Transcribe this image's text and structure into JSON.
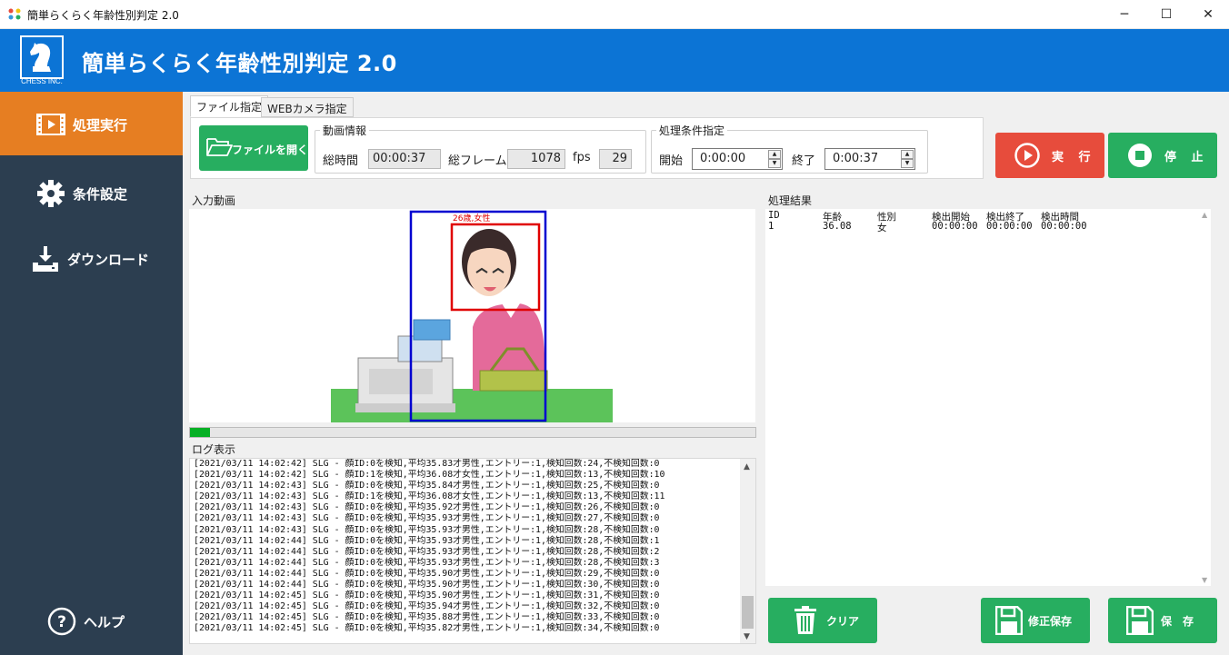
{
  "window": {
    "title": "簡単らくらく年齢性別判定 2.0",
    "minimize": "─",
    "maximize": "☐",
    "close": "✕"
  },
  "header": {
    "logo_text": "CHESS INC.",
    "app_title": "簡単らくらく年齢性別判定 2.0"
  },
  "sidebar": {
    "items": [
      {
        "label": "処理実行",
        "icon": "film-icon",
        "active": true
      },
      {
        "label": "条件設定",
        "icon": "gear-icon",
        "active": false
      },
      {
        "label": "ダウンロード",
        "icon": "download-icon",
        "active": false
      }
    ],
    "help": "ヘルプ"
  },
  "tabs": [
    "ファイル指定",
    "WEBカメラ指定"
  ],
  "file": {
    "open_label": "ファイルを開く",
    "video_info": {
      "legend": "動画情報",
      "total_time_label": "総時間",
      "total_time": "00:00:37",
      "total_frames_label": "総フレーム",
      "total_frames": "1078",
      "fps_label": "fps",
      "fps": "29"
    },
    "conditions": {
      "legend": "処理条件指定",
      "start_label": "開始",
      "start": "0:00:00",
      "end_label": "終了",
      "end": "0:00:37"
    }
  },
  "actions": {
    "run": "実 行",
    "stop": "停 止"
  },
  "input_video": {
    "label": "入力動画",
    "face_label": "26歳,女性",
    "progress": 0.035
  },
  "log": {
    "label": "ログ表示",
    "lines": [
      "[2021/03/11 14:02:42] SLG - 顔ID:0を検知,平均35.83才男性,エントリー:1,検知回数:24,不検知回数:0",
      "[2021/03/11 14:02:42] SLG - 顔ID:1を検知,平均36.08才女性,エントリー:1,検知回数:13,不検知回数:10",
      "[2021/03/11 14:02:43] SLG - 顔ID:0を検知,平均35.84才男性,エントリー:1,検知回数:25,不検知回数:0",
      "[2021/03/11 14:02:43] SLG - 顔ID:1を検知,平均36.08才女性,エントリー:1,検知回数:13,不検知回数:11",
      "[2021/03/11 14:02:43] SLG - 顔ID:0を検知,平均35.92才男性,エントリー:1,検知回数:26,不検知回数:0",
      "[2021/03/11 14:02:43] SLG - 顔ID:0を検知,平均35.93才男性,エントリー:1,検知回数:27,不検知回数:0",
      "[2021/03/11 14:02:43] SLG - 顔ID:0を検知,平均35.93才男性,エントリー:1,検知回数:28,不検知回数:0",
      "[2021/03/11 14:02:44] SLG - 顔ID:0を検知,平均35.93才男性,エントリー:1,検知回数:28,不検知回数:1",
      "[2021/03/11 14:02:44] SLG - 顔ID:0を検知,平均35.93才男性,エントリー:1,検知回数:28,不検知回数:2",
      "[2021/03/11 14:02:44] SLG - 顔ID:0を検知,平均35.93才男性,エントリー:1,検知回数:28,不検知回数:3",
      "[2021/03/11 14:02:44] SLG - 顔ID:0を検知,平均35.90才男性,エントリー:1,検知回数:29,不検知回数:0",
      "[2021/03/11 14:02:44] SLG - 顔ID:0を検知,平均35.90才男性,エントリー:1,検知回数:30,不検知回数:0",
      "[2021/03/11 14:02:45] SLG - 顔ID:0を検知,平均35.90才男性,エントリー:1,検知回数:31,不検知回数:0",
      "[2021/03/11 14:02:45] SLG - 顔ID:0を検知,平均35.94才男性,エントリー:1,検知回数:32,不検知回数:0",
      "[2021/03/11 14:02:45] SLG - 顔ID:0を検知,平均35.88才男性,エントリー:1,検知回数:33,不検知回数:0",
      "[2021/03/11 14:02:45] SLG - 顔ID:0を検知,平均35.82才男性,エントリー:1,検知回数:34,不検知回数:0"
    ]
  },
  "results": {
    "label": "処理結果",
    "columns": [
      "ID",
      "年齢",
      "性別",
      "検出開始",
      "検出終了",
      "検出時間"
    ],
    "rows": [
      [
        "1",
        "36.08",
        "女",
        "00:00:00",
        "00:00:00",
        "00:00:00"
      ]
    ]
  },
  "bottom_buttons": {
    "clear": "クリア",
    "save_edit": "修正保存",
    "save": "保　存"
  },
  "colors": {
    "header_blue": "#0c74d5",
    "sidebar": "#2c3e50",
    "active_orange": "#e67e22",
    "green": "#27ae60",
    "red": "#e74c3c",
    "face_box": "#e00000",
    "body_box": "#0000d0"
  }
}
